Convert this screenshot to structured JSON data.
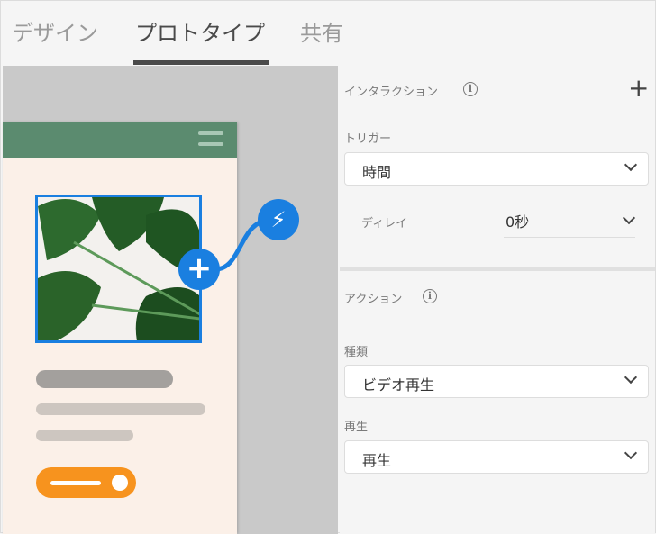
{
  "tabs": [
    {
      "label": "デザイン"
    },
    {
      "label": "プロトタイプ"
    },
    {
      "label": "共有"
    }
  ],
  "panel": {
    "interaction_title": "インタラクション",
    "trigger_label": "トリガー",
    "trigger_value": "時間",
    "delay_label": "ディレイ",
    "delay_value": "0秒",
    "action_title": "アクション",
    "type_label": "種類",
    "type_value": "ビデオ再生",
    "play_label": "再生",
    "play_value": "再生"
  },
  "colors": {
    "accent": "#1a7fe0",
    "header": "#5b8b6f",
    "button": "#f7931e"
  }
}
